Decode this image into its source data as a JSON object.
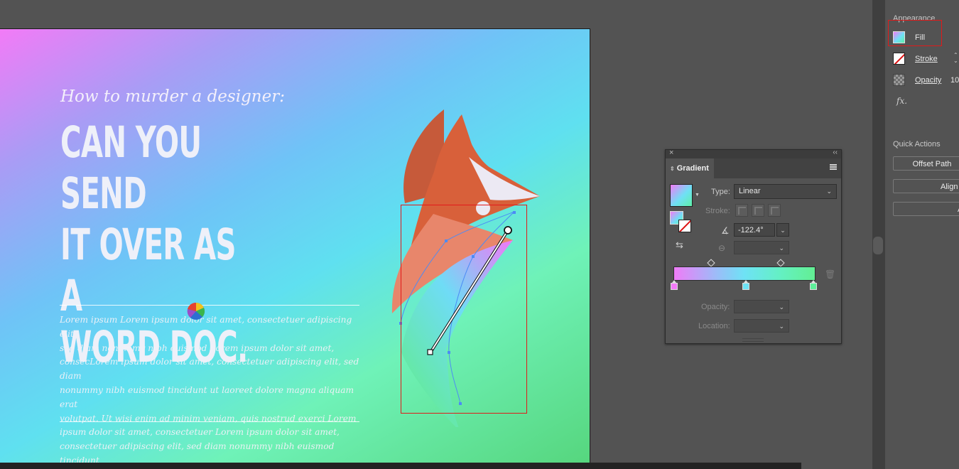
{
  "artboard": {
    "subtitle": "How to murder a designer:",
    "headline": [
      "CAN YOU SEND",
      "IT OVER AS A",
      "WORD DOC."
    ],
    "body_lines": [
      "Lorem ipsum Lorem ipsum dolor sit amet, consectetuer adipiscing elit,",
      "sed diam nonummy nibh euismod Lorem ipsum dolor sit amet,",
      "consecLorem ipsum dolor sit amet, consectetuer adipiscing elit, sed diam",
      "nonummy nibh euismod tincidunt ut laoreet dolore magna aliquam erat",
      "volutpat. Ut wisi enim ad minim veniam, quis nostrud exerci Lorem",
      "ipsum dolor sit amet, consectetuer Lorem ipsum dolor sit amet,",
      "consectetuer adipiscing elit, sed diam nonummy nibh euismod tincidunt"
    ]
  },
  "gradient_panel": {
    "tab_label": "Gradient",
    "type_label": "Type:",
    "type_value": "Linear",
    "stroke_label": "Stroke:",
    "angle_value": "-122.4°",
    "opacity_label": "Opacity:",
    "location_label": "Location:",
    "stop_colors": [
      "#f27bf7",
      "#6ee2f5",
      "#5ef09a"
    ],
    "midpoints": [
      0.25,
      0.75
    ]
  },
  "appearance_panel": {
    "title": "Appearance",
    "fill_label": "Fill",
    "stroke_label": "Stroke",
    "opacity_label": "Opacity",
    "opacity_value": "10",
    "fx_label": "fx.",
    "quick_actions_title": "Quick Actions",
    "offset_path_label": "Offset Path",
    "align_label": "Align",
    "third_action_label": "A"
  },
  "colors": {
    "highlight_red": "#e11a1a",
    "panel_bg": "#535353"
  }
}
